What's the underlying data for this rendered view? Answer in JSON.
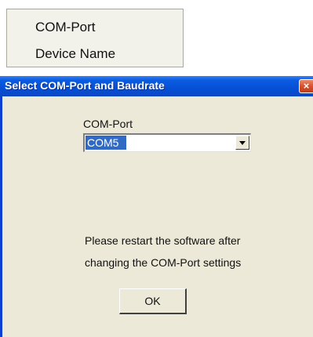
{
  "context_menu": {
    "items": [
      {
        "label": "COM-Port"
      },
      {
        "label": "Device Name"
      }
    ]
  },
  "dialog": {
    "title": "Select COM-Port and Baudrate",
    "close_icon": "close-icon",
    "com_port_label": "COM-Port",
    "com_port_value": "COM5",
    "message_line1": "Please restart the software after",
    "message_line2": "changing the COM-Port settings",
    "ok_label": "OK",
    "close_glyph": "×"
  },
  "colors": {
    "titlebar": "#0650d6",
    "dialog_bg": "#ece9d8",
    "selection": "#316ac5",
    "close_button": "#d8502d"
  }
}
